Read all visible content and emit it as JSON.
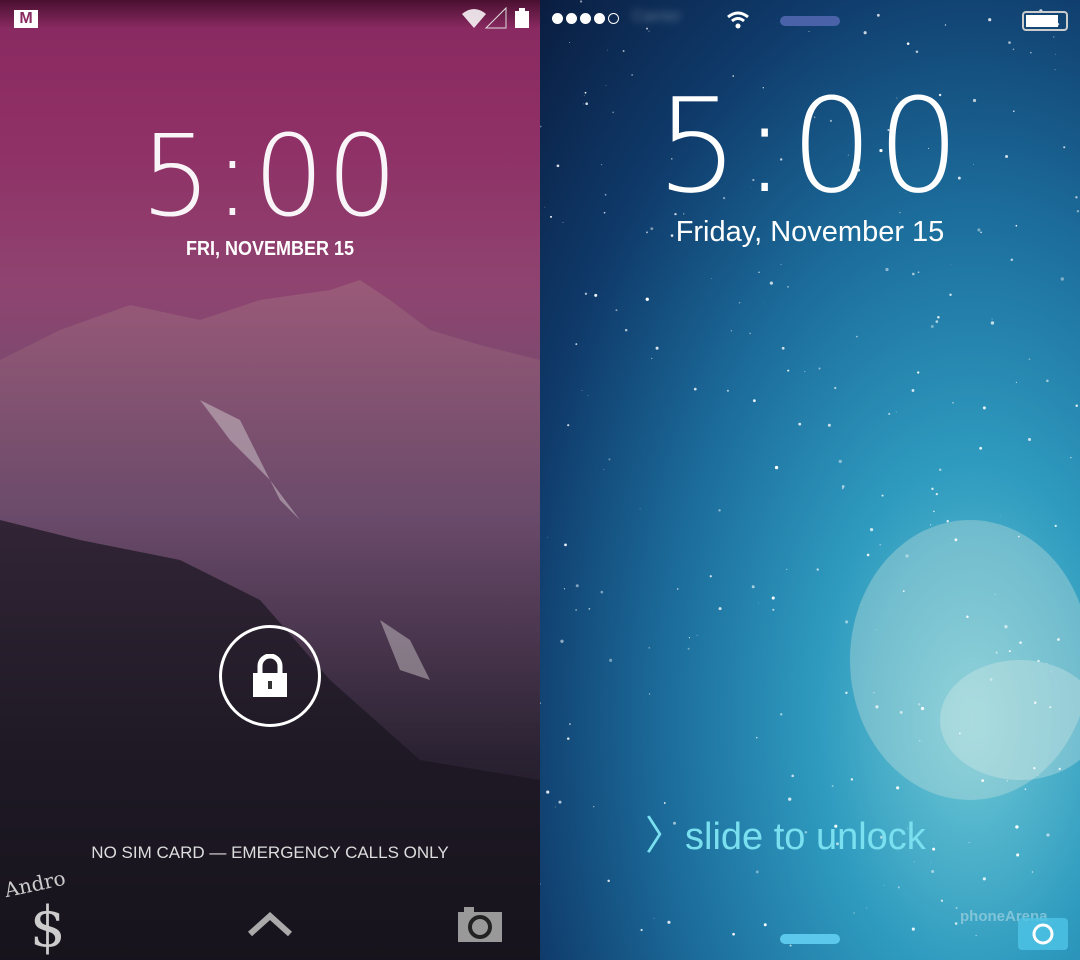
{
  "android": {
    "status": {
      "icons": [
        "gmail-icon",
        "wifi-icon",
        "signal-icon",
        "battery-icon"
      ]
    },
    "clock": "5:00",
    "date": "FRI, NOVEMBER 15",
    "carrier_message": "NO SIM CARD — EMERGENCY CALLS ONLY",
    "watermark": "Andro $",
    "colors": {
      "sky": "#8f3066"
    }
  },
  "ios": {
    "status": {
      "signal_dots": 5,
      "signal_filled": 4,
      "carrier": "Carrier",
      "battery_level": 0.85
    },
    "clock": "5:00",
    "date": "Friday, November 15",
    "slide_label": "slide to unlock",
    "watermark": "phoneArena",
    "colors": {
      "accent": "#7ae0ef"
    }
  }
}
